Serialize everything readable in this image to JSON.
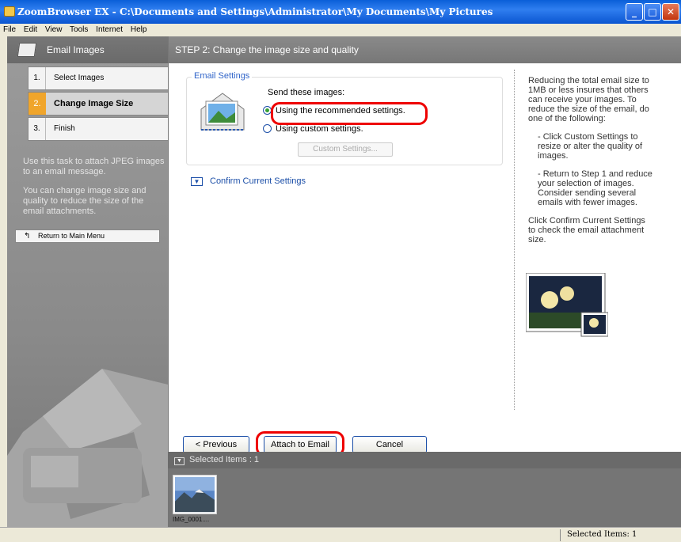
{
  "window": {
    "title": "ZoomBrowser EX  -  C:\\Documents and Settings\\Administrator\\My Documents\\My Pictures"
  },
  "menu": [
    "File",
    "Edit",
    "View",
    "Tools",
    "Internet",
    "Help"
  ],
  "sidebar": {
    "title": "Email Images",
    "steps": [
      {
        "num": "1.",
        "label": "Select Images"
      },
      {
        "num": "2.",
        "label": "Change Image Size"
      },
      {
        "num": "3.",
        "label": "Finish"
      }
    ],
    "desc1": "Use this task to attach JPEG images to an email message.",
    "desc2": "You can change image size and quality to reduce the size of the email attachments.",
    "return_label": "Return to Main Menu"
  },
  "main": {
    "header": "STEP 2: Change the image size and quality",
    "group_title": "Email Settings",
    "send_label": "Send these images:",
    "radio1": "Using the recommended settings.",
    "radio2": "Using custom settings.",
    "custom_btn": "Custom Settings...",
    "confirm": "Confirm Current Settings",
    "help1": "Reducing the total email size to 1MB or less insures that others can receive your images. To reduce the size of the email, do one of the following:",
    "help2": "- Click Custom Settings to resize or alter the quality of images.",
    "help3": "- Return to Step 1 and reduce your selection of images. Consider sending several emails with fewer images.",
    "help4": "Click Confirm Current Settings to check the email attachment size."
  },
  "buttons": {
    "previous": "< Previous",
    "attach": "Attach to Email",
    "cancel": "Cancel"
  },
  "strip": {
    "header": "Selected Items : 1",
    "thumb_label": "IMG_0001...."
  },
  "status": {
    "text": "Selected Items: 1"
  }
}
